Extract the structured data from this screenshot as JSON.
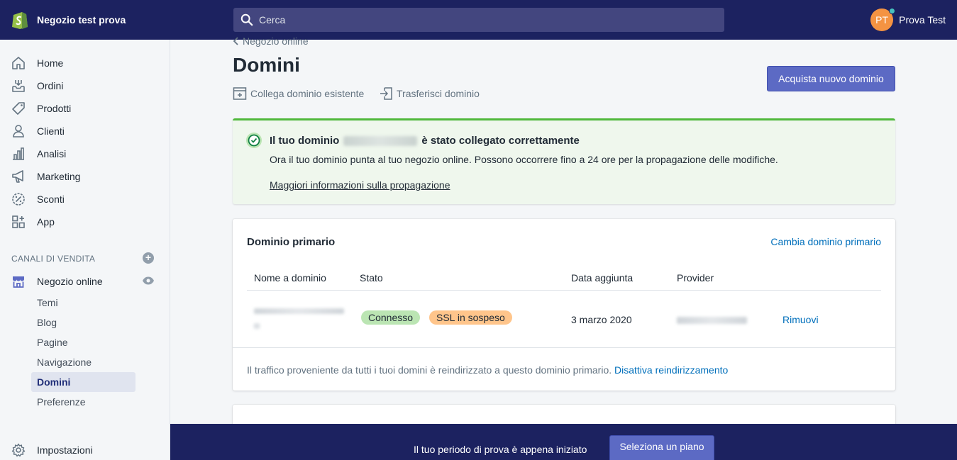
{
  "brand": {
    "name": "Negozio test prova"
  },
  "search": {
    "placeholder": "Cerca"
  },
  "user": {
    "initials": "PT",
    "name": "Prova Test"
  },
  "colors": {
    "topbar": "#1c2260",
    "accent": "#5c6ac4",
    "success": "#50b83c",
    "link": "#006fbb"
  },
  "sidebar": {
    "items": [
      {
        "label": "Home",
        "icon": "home-icon"
      },
      {
        "label": "Ordini",
        "icon": "orders-icon"
      },
      {
        "label": "Prodotti",
        "icon": "tag-icon"
      },
      {
        "label": "Clienti",
        "icon": "person-icon"
      },
      {
        "label": "Analisi",
        "icon": "chart-icon"
      },
      {
        "label": "Marketing",
        "icon": "megaphone-icon"
      },
      {
        "label": "Sconti",
        "icon": "discount-icon"
      },
      {
        "label": "App",
        "icon": "apps-icon"
      }
    ],
    "channels_title": "CANALI DI VENDITA",
    "online_store": "Negozio online",
    "sub_items": [
      "Temi",
      "Blog",
      "Pagine",
      "Navigazione",
      "Domini",
      "Preferenze"
    ],
    "active_sub": "Domini",
    "settings": "Impostazioni"
  },
  "page": {
    "breadcrumb": "Negozio online",
    "title": "Domini",
    "actions": {
      "connect": "Collega dominio esistente",
      "transfer": "Trasferisci dominio"
    },
    "buy_button": "Acquista nuovo dominio"
  },
  "banner": {
    "title_before": "Il tuo dominio",
    "title_after": "è stato collegato correttamente",
    "text": "Ora il tuo dominio punta al tuo negozio online. Possono occorrere fino a 24 ore per la propagazione delle modifiche.",
    "link": "Maggiori informazioni sulla propagazione"
  },
  "primary_domain": {
    "title": "Dominio primario",
    "change_link": "Cambia dominio primario",
    "columns": [
      "Nome a dominio",
      "Stato",
      "Data aggiunta",
      "Provider"
    ],
    "row": {
      "status_connected": "Connesso",
      "status_ssl": "SSL in sospeso",
      "date_added": "3 marzo 2020",
      "remove": "Rimuovi"
    },
    "footer_text": "Il traffico proveniente da tutti i tuoi domini è reindirizzato a questo dominio primario.",
    "footer_link": "Disattiva reindirizzamento"
  },
  "trial": {
    "text": "Il tuo periodo di prova è appena iniziato",
    "button": "Seleziona un piano"
  }
}
